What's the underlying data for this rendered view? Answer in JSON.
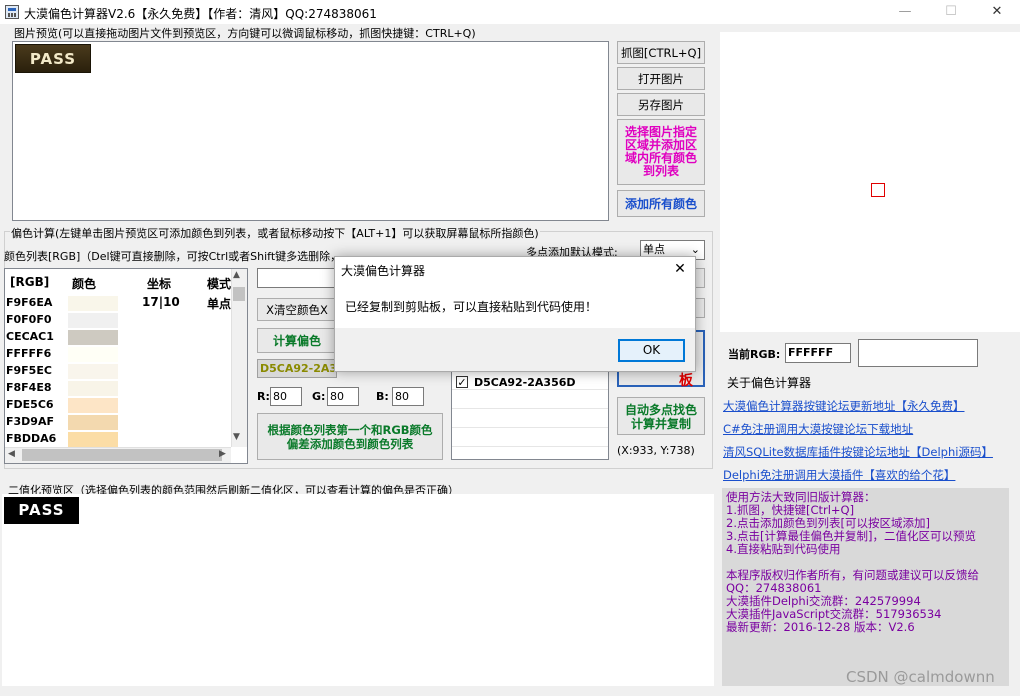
{
  "window": {
    "title": "大漠偏色计算器V2.6【永久免费】【作者：清风】QQ:274838061",
    "minimize": "—",
    "maximize": "☐",
    "close": "✕"
  },
  "preview": {
    "label": "图片预览(可以直接拖动图片文件到预览区，方向键可以微调鼠标移动，抓图快捷键：CTRL+Q)",
    "image_text": "PASS"
  },
  "right_buttons": {
    "capture": "抓图[CTRL+Q]",
    "open": "打开图片",
    "save_as": "另存图片",
    "select_region": [
      "选择图片指定",
      "区域并添加区",
      "域内所有颜色",
      "到列表"
    ],
    "add_all": "添加所有颜色"
  },
  "calc": {
    "label": "偏色计算(左键单击图片预览区可添加颜色到列表，或者鼠标移动按下【ALT+1】可以获取屏幕鼠标所指颜色)",
    "list_label": "颜色列表[RGB]（Del键可直接删除，可按Ctrl或者Shift键多选删除，点击列头可以排序颜色）",
    "multi_label": "多点添加默认模式:",
    "multi_value": "单点",
    "columns": [
      "[RGB]",
      "颜色",
      "坐标",
      "模式"
    ],
    "first_row": {
      "coord": "17|10",
      "mode": "单点"
    },
    "rows": [
      {
        "rgb": "F9F6EA",
        "color": "#F9F6EA"
      },
      {
        "rgb": "F0F0F0",
        "color": "#F0F0F0"
      },
      {
        "rgb": "CECAC1",
        "color": "#CECAC1"
      },
      {
        "rgb": "FFFFF6",
        "color": "#FFFFF6"
      },
      {
        "rgb": "F9F5EC",
        "color": "#F9F5EC"
      },
      {
        "rgb": "F8F4E8",
        "color": "#F8F4E8"
      },
      {
        "rgb": "FDE5C6",
        "color": "#FDE5C6"
      },
      {
        "rgb": "F3D9AF",
        "color": "#F3D9AF"
      },
      {
        "rgb": "FBDDA6",
        "color": "#FBDDA6"
      }
    ],
    "clear_btn": "X清空颜色X",
    "calc_btn": "计算偏色",
    "result": "D5CA92-2A356D",
    "r_label": "R:",
    "r_value": "80",
    "g_label": "G:",
    "g_value": "80",
    "b_label": "B:",
    "b_value": "80",
    "add_by_btn": [
      "根据颜色列表第一个和RGB颜色",
      "偏差添加颜色到颜色列表"
    ],
    "list2_item": "D5CA92-2A356D",
    "list2_check": "✓",
    "red_btn_text": "板",
    "auto_btn": [
      "自动多点找色",
      "计算并复制"
    ],
    "coord_display": "(X:933, Y:738)"
  },
  "current": {
    "label": "当前RGB:",
    "value": "FFFFFF"
  },
  "about": {
    "label": "关于偏色计算器",
    "links": [
      "大漠偏色计算器按键论坛更新地址【永久免费】",
      "C#免注册调用大漠按键论坛下载地址",
      "清风SQLite数据库插件按键论坛地址【Delphi源码】",
      "Delphi免注册调用大漠插件【喜欢的给个花】"
    ],
    "info": [
      "使用方法大致同旧版计算器：",
      "1.抓图，快捷键[Ctrl+Q]",
      "2.点击添加颜色到列表[可以按区域添加]",
      "3.点击[计算最佳偏色并复制]，二值化区可以预览",
      "4.直接粘贴到代码使用",
      "",
      "本程序版权归作者所有，有问题或建议可以反馈给",
      "QQ：274838061",
      "大漠插件Delphi交流群：242579994",
      "大漠插件JavaScript交流群：517936534",
      "最新更新：2016-12-28 版本：V2.6"
    ]
  },
  "binary": {
    "label": "二值化预览区（选择偏色列表的颜色范围然后刷新二值化区，可以查看计算的偏色是否正确）",
    "image_text": "PASS"
  },
  "dialog": {
    "title": "大漠偏色计算器",
    "close": "✕",
    "message": "已经复制到剪贴板，可以直接粘贴到代码使用！",
    "ok": "OK"
  },
  "watermark": "CSDN @calmdownn",
  "colors": {
    "magenta": "#e000c0",
    "link_blue": "#1a4fcc",
    "info_purple": "#7a00a0",
    "green": "#0a7a2a",
    "red_marker": "#e00000",
    "result_olive": "#8a8a00"
  }
}
